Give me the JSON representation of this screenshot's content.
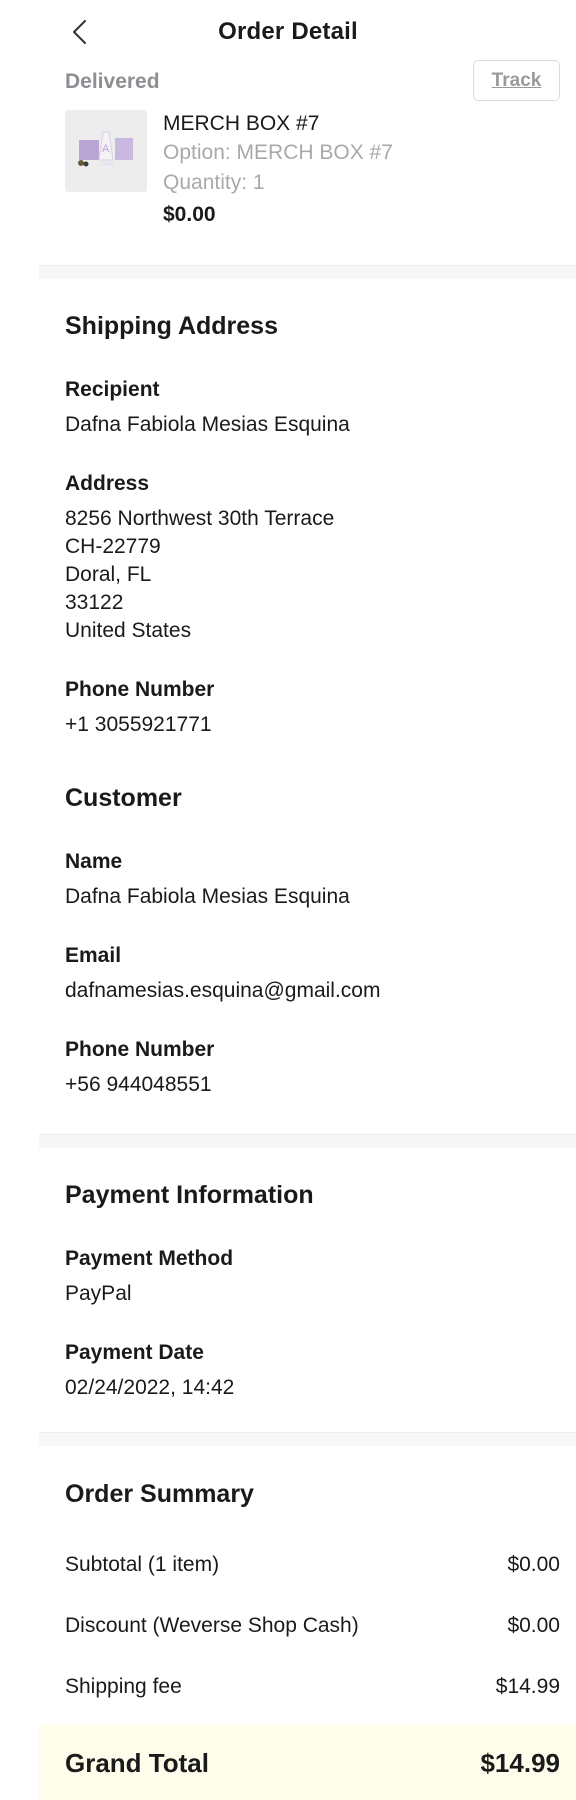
{
  "header": {
    "title": "Order Detail",
    "back_icon": "chevron-left-icon"
  },
  "item": {
    "status": "Delivered",
    "track_label": "Track",
    "name": "MERCH BOX #7",
    "option": "Option: MERCH BOX #7",
    "quantity": "Quantity: 1",
    "price": "$0.00"
  },
  "shipping": {
    "title": "Shipping Address",
    "recipient_label": "Recipient",
    "recipient": "Dafna Fabiola Mesias Esquina",
    "address_label": "Address",
    "address_lines": [
      "8256 Northwest 30th Terrace",
      "CH-22779",
      "Doral, FL",
      "33122",
      "United States"
    ],
    "phone_label": "Phone Number",
    "phone": "+1 3055921771"
  },
  "customer": {
    "title": "Customer",
    "name_label": "Name",
    "name": "Dafna Fabiola Mesias Esquina",
    "email_label": "Email",
    "email": "dafnamesias.esquina@gmail.com",
    "phone_label": "Phone Number",
    "phone": "+56 944048551"
  },
  "payment": {
    "title": "Payment Information",
    "method_label": "Payment Method",
    "method": "PayPal",
    "date_label": "Payment Date",
    "date": "02/24/2022, 14:42"
  },
  "summary": {
    "title": "Order Summary",
    "rows": [
      {
        "label": "Subtotal (1 item)",
        "value": "$0.00"
      },
      {
        "label": "Discount (Weverse Shop Cash)",
        "value": "$0.00"
      },
      {
        "label": "Shipping fee",
        "value": "$14.99"
      }
    ],
    "grand_label": "Grand Total",
    "grand_value": "$14.99"
  },
  "colors": {
    "muted": "#8e8e93",
    "accent_purple": "#b9a6d4",
    "grand_bg": "#fefdeb"
  }
}
